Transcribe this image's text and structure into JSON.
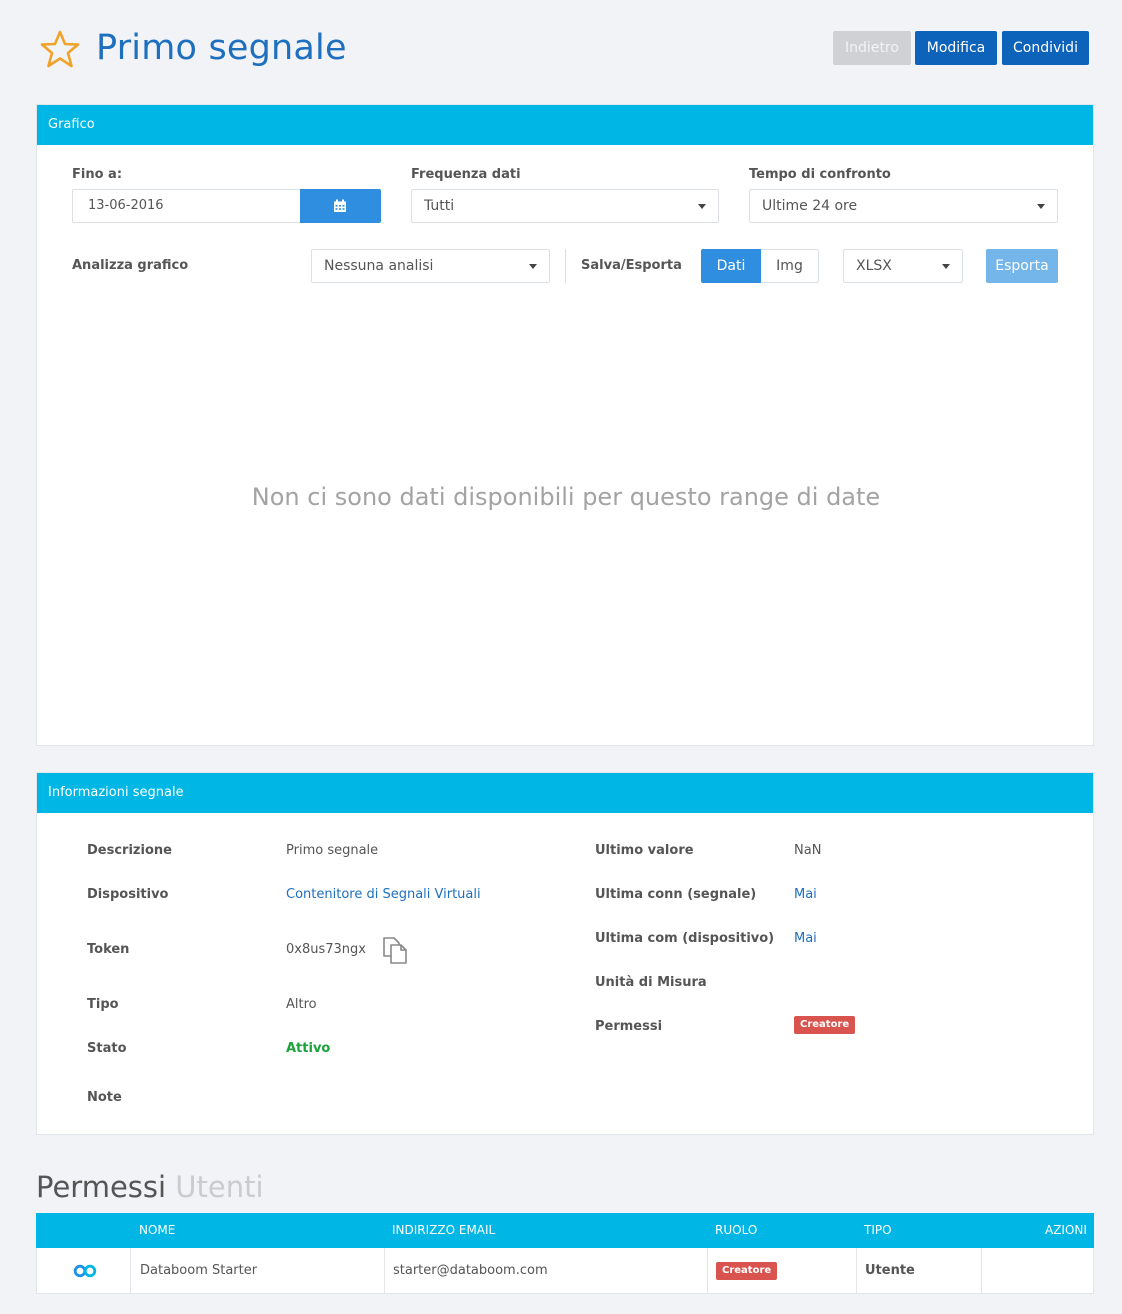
{
  "header": {
    "title": "Primo segnale",
    "back_label": "Indietro",
    "edit_label": "Modifica",
    "share_label": "Condividi"
  },
  "chart_panel": {
    "title": "Grafico",
    "until_label": "Fino a:",
    "until_value": "13-06-2016",
    "frequency_label": "Frequenza dati",
    "frequency_value": "Tutti",
    "compare_label": "Tempo di confronto",
    "compare_value": "Ultime 24 ore",
    "analyze_label": "Analizza grafico",
    "analyze_value": "Nessuna analisi",
    "save_export_label": "Salva/Esporta",
    "toggle_data": "Dati",
    "toggle_img": "Img",
    "format_value": "XLSX",
    "export_label": "Esporta",
    "empty_message": "Non ci sono dati disponibili per questo range di date"
  },
  "info_panel": {
    "title": "Informazioni segnale",
    "description_label": "Descrizione",
    "description_value": "Primo segnale",
    "device_label": "Dispositivo",
    "device_value": "Contenitore di Segnali Virtuali",
    "token_label": "Token",
    "token_value": "0x8us73ngx",
    "type_label": "Tipo",
    "type_value": "Altro",
    "state_label": "Stato",
    "state_value": "Attivo",
    "notes_label": "Note",
    "last_value_label": "Ultimo valore",
    "last_value_value": "NaN",
    "last_conn_label": "Ultima conn (segnale)",
    "last_conn_value": "Mai",
    "last_com_label": "Ultima com (dispositivo)",
    "last_com_value": "Mai",
    "unit_label": "Unità di Misura",
    "permissions_label": "Permessi",
    "permissions_badge": "Creatore"
  },
  "permissions": {
    "title": "Permessi",
    "subtitle": "Utenti",
    "columns": [
      "NOME",
      "INDIRIZZO EMAIL",
      "RUOLO",
      "TIPO",
      "AZIONI"
    ],
    "rows": [
      {
        "name": "Databoom Starter",
        "email": "starter@databoom.com",
        "role": "Creatore",
        "type": "Utente"
      }
    ]
  },
  "colors": {
    "accent": "#00b6e4",
    "primary": "#0d62b9",
    "badge": "#d9534f",
    "active": "#1aa23b"
  }
}
